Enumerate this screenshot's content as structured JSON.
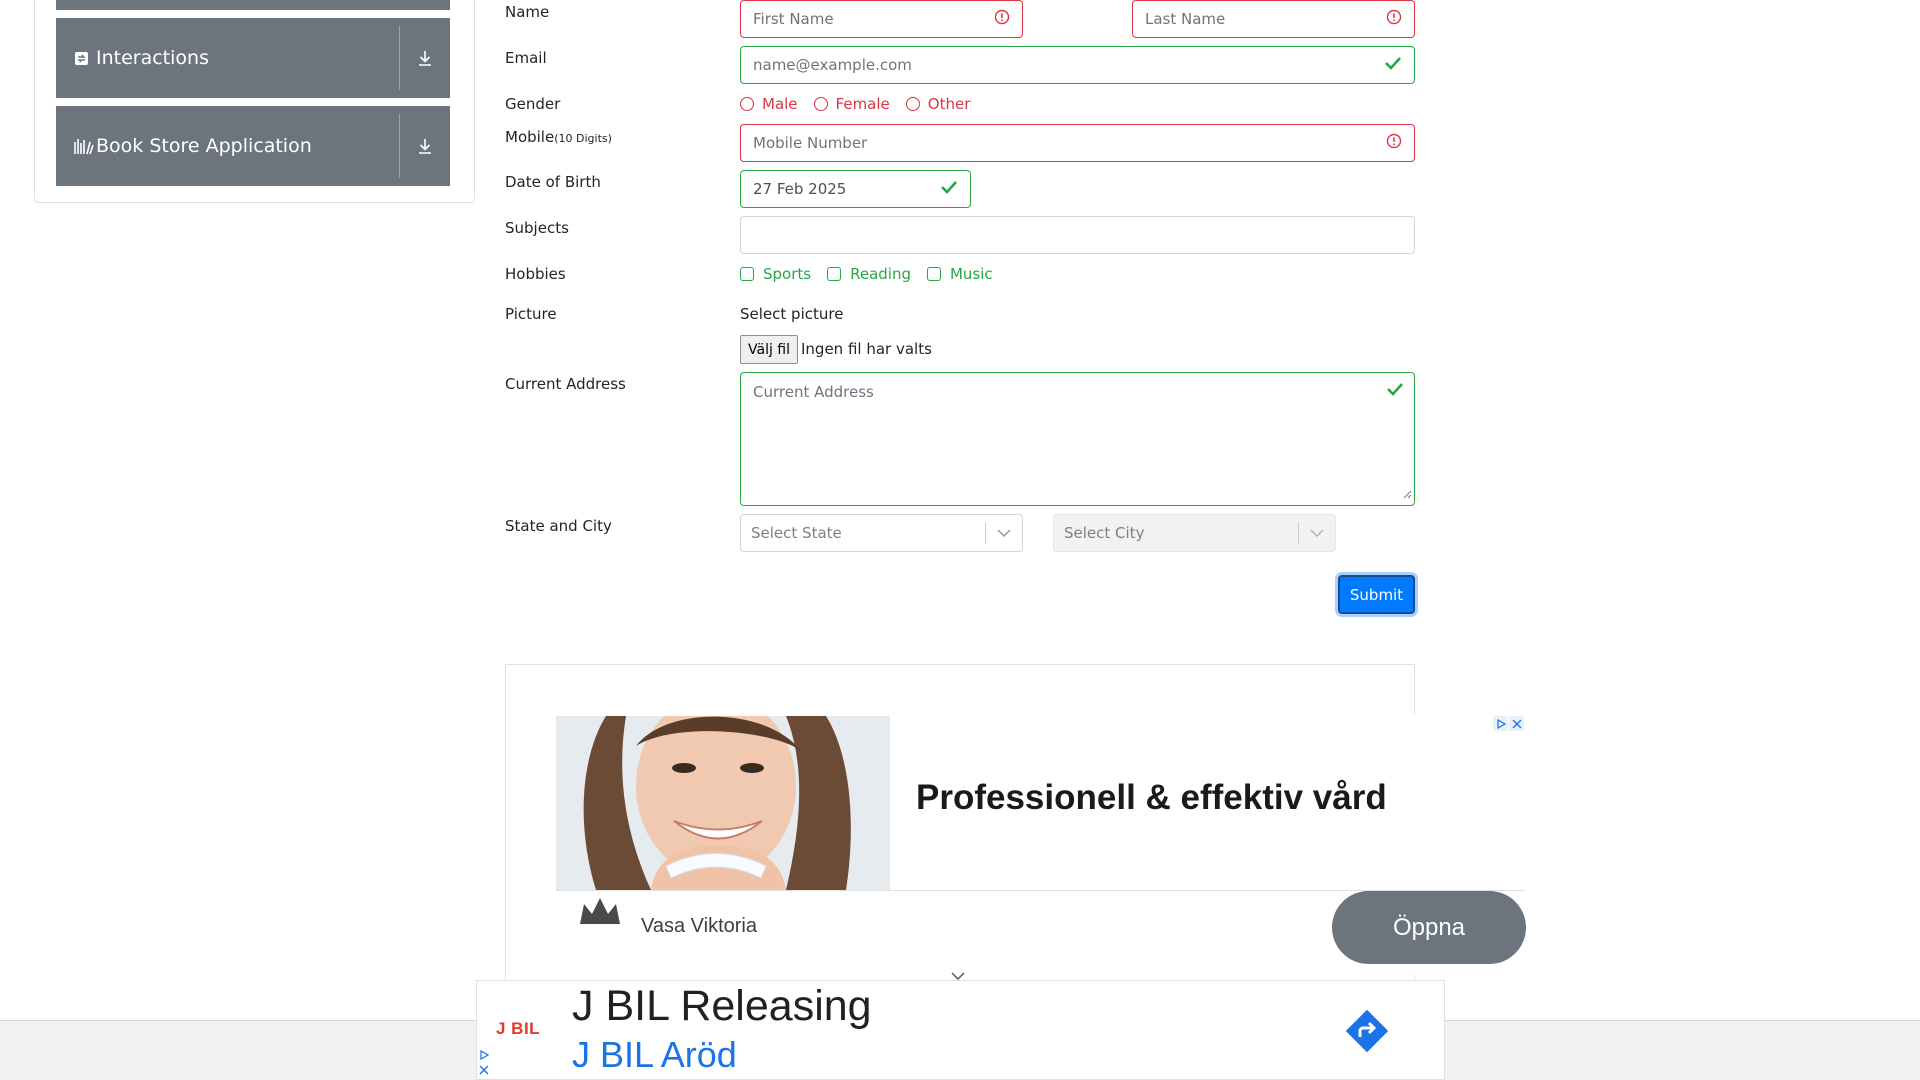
{
  "sidebar": {
    "groups": [
      {
        "label": "Interactions",
        "icon": "interactions-icon"
      },
      {
        "label": "Book Store Application",
        "icon": "book-store-icon"
      }
    ]
  },
  "form": {
    "name": {
      "label": "Name",
      "first_placeholder": "First Name",
      "last_placeholder": "Last Name"
    },
    "email": {
      "label": "Email",
      "placeholder": "name@example.com"
    },
    "gender": {
      "label": "Gender",
      "options": [
        "Male",
        "Female",
        "Other"
      ]
    },
    "mobile": {
      "label": "Mobile",
      "hint": "(10 Digits)",
      "placeholder": "Mobile Number"
    },
    "dob": {
      "label": "Date of Birth",
      "value": "27 Feb 2025"
    },
    "subjects": {
      "label": "Subjects",
      "value": ""
    },
    "hobbies": {
      "label": "Hobbies",
      "options": [
        "Sports",
        "Reading",
        "Music"
      ]
    },
    "picture": {
      "label": "Picture",
      "caption": "Select picture",
      "button": "Välj fil",
      "status": "Ingen fil har valts"
    },
    "address": {
      "label": "Current Address",
      "placeholder": "Current Address"
    },
    "state_city": {
      "label": "State and City",
      "state_placeholder": "Select State",
      "city_placeholder": "Select City"
    },
    "submit": "Submit"
  },
  "ad": {
    "headline": "Professionell & effektiv vård",
    "brand": "Vasa Viktoria",
    "cta": "Öppna"
  },
  "bottom_ad": {
    "logo": "J BIL",
    "title": "J BIL Releasing",
    "subtitle": "J BIL Aröd"
  },
  "colors": {
    "invalid": "#dc3545",
    "valid": "#28a745",
    "primary": "#007bff",
    "sidebar_group": "#6c757d"
  }
}
